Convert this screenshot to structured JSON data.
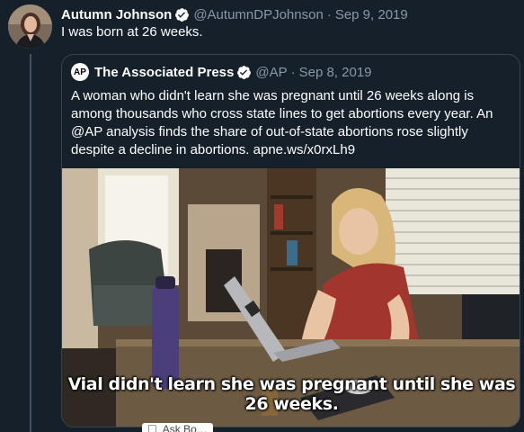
{
  "colors": {
    "background": "#15202b",
    "secondary_text": "#8899a6",
    "border": "#38444d",
    "verified": "#ffffff"
  },
  "tweet": {
    "author_name": "Autumn Johnson",
    "handle": "@AutumnDPJohnson",
    "separator": "·",
    "date": "Sep 9, 2019",
    "text": "I was born at 26 weeks.",
    "avatar_icon": "avatar-photo",
    "verified_icon": "verified-badge-icon"
  },
  "quoted_tweet": {
    "logo_text": "AP",
    "author_name": "The Associated Press",
    "handle": "@AP",
    "separator": "·",
    "date": "Sep 8, 2019",
    "text": "A woman who didn't learn she was pregnant until 26 weeks along is among thousands who cross state lines to get abortions every year. An @AP analysis finds the share of out-of-state abortions rose slightly despite a decline in abortions. apne.ws/x0rxLh9",
    "video": {
      "caption": "Vial didn't learn she was pregnant until she was 26 weeks."
    }
  },
  "partial_toolbar": {
    "label": "Ask Bo…"
  }
}
